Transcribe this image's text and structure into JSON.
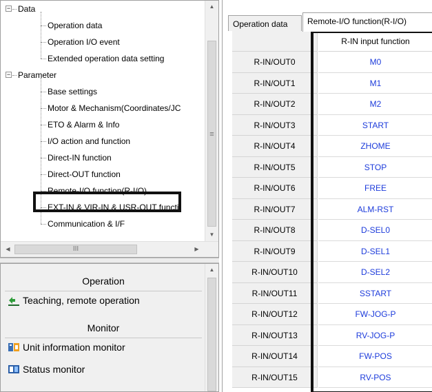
{
  "tree": {
    "items": [
      {
        "label": "Data",
        "level": 0,
        "expander": "−"
      },
      {
        "label": "Operation data",
        "level": 1
      },
      {
        "label": "Operation I/O event",
        "level": 1
      },
      {
        "label": "Extended operation data setting",
        "level": 1
      },
      {
        "label": "Parameter",
        "level": 0,
        "expander": "−"
      },
      {
        "label": "Base settings",
        "level": 1
      },
      {
        "label": "Motor & Mechanism(Coordinates/JC",
        "level": 1
      },
      {
        "label": "ETO & Alarm & Info",
        "level": 1
      },
      {
        "label": "I/O action and function",
        "level": 1
      },
      {
        "label": "Direct-IN function",
        "level": 1
      },
      {
        "label": "Direct-OUT function",
        "level": 1
      },
      {
        "label": "Remote-I/O function(R-I/O)",
        "level": 1,
        "highlighted": true
      },
      {
        "label": "EXT-IN & VIR-IN & USR-OUT functi",
        "level": 1
      },
      {
        "label": "Communication & I/F",
        "level": 1
      }
    ],
    "vscroll_glyph": "≡",
    "hscroll_glyph": "III",
    "arrow_up": "▲",
    "arrow_down": "▼",
    "arrow_left": "◀",
    "arrow_right": "▶"
  },
  "nav": {
    "sections": [
      {
        "header": "Operation",
        "items": [
          {
            "label": "Teaching, remote operation",
            "icon": "teaching-icon"
          }
        ]
      },
      {
        "header": "Monitor",
        "items": [
          {
            "label": "Unit information monitor",
            "icon": "unit-info-icon"
          },
          {
            "label": "Status monitor",
            "icon": "status-monitor-icon"
          }
        ]
      }
    ]
  },
  "tabs": [
    {
      "label": "Operation data",
      "active": false
    },
    {
      "label": "Remote-I/O function(R-I/O)",
      "active": true
    }
  ],
  "grid": {
    "column_header": "R-IN input function",
    "rows": [
      {
        "name": "R-IN/OUT0",
        "value": "M0"
      },
      {
        "name": "R-IN/OUT1",
        "value": "M1"
      },
      {
        "name": "R-IN/OUT2",
        "value": "M2"
      },
      {
        "name": "R-IN/OUT3",
        "value": "START"
      },
      {
        "name": "R-IN/OUT4",
        "value": "ZHOME"
      },
      {
        "name": "R-IN/OUT5",
        "value": "STOP"
      },
      {
        "name": "R-IN/OUT6",
        "value": "FREE"
      },
      {
        "name": "R-IN/OUT7",
        "value": "ALM-RST"
      },
      {
        "name": "R-IN/OUT8",
        "value": "D-SEL0"
      },
      {
        "name": "R-IN/OUT9",
        "value": "D-SEL1"
      },
      {
        "name": "R-IN/OUT10",
        "value": "D-SEL2"
      },
      {
        "name": "R-IN/OUT11",
        "value": "SSTART"
      },
      {
        "name": "R-IN/OUT12",
        "value": "FW-JOG-P"
      },
      {
        "name": "R-IN/OUT13",
        "value": "RV-JOG-P"
      },
      {
        "name": "R-IN/OUT14",
        "value": "FW-POS"
      },
      {
        "name": "R-IN/OUT15",
        "value": "RV-POS"
      }
    ]
  },
  "colors": {
    "value_text": "#1c3bdb",
    "highlight": "#111111"
  }
}
